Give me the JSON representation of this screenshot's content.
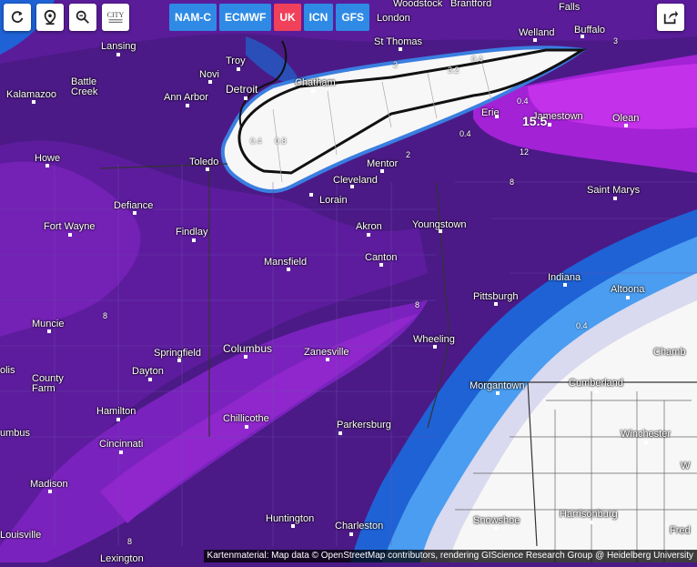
{
  "controls": {
    "refresh_icon": "refresh-icon",
    "location_icon": "location-pin-icon",
    "zoom_icon": "zoom-out-icon",
    "city_label": "CITY",
    "share_icon": "share-icon"
  },
  "models": [
    {
      "label": "NAM-C",
      "active": false
    },
    {
      "label": "ECMWF",
      "active": false
    },
    {
      "label": "UK",
      "active": true
    },
    {
      "label": "ICN",
      "active": false
    },
    {
      "label": "GFS",
      "active": false
    }
  ],
  "cities": {
    "woodstock": "Woodstock",
    "brantford": "Brantford",
    "falls": "Falls",
    "london": "London",
    "welland": "Welland",
    "buffalo": "Buffalo",
    "lansing": "Lansing",
    "troy": "Troy",
    "st_thomas": "St Thomas",
    "novi": "Novi",
    "battle_creek": "Battle Creek",
    "detroit": "Detroit",
    "chatham": "Chatham",
    "kalamazoo": "Kalamazoo",
    "ann_arbor": "Ann Arbor",
    "erie": "Erie",
    "jamestown": "Jamestown",
    "olean": "Olean",
    "howe": "Howe",
    "toledo": "Toledo",
    "mentor": "Mentor",
    "cleveland": "Cleveland",
    "lorain": "Lorain",
    "saint_marys": "Saint Marys",
    "defiance": "Defiance",
    "fort_wayne": "Fort Wayne",
    "akron": "Akron",
    "youngstown": "Youngstown",
    "findlay": "Findlay",
    "mansfield": "Mansfield",
    "canton": "Canton",
    "indiana": "Indiana",
    "altoona": "Altoona",
    "pittsburgh": "Pittsburgh",
    "muncie": "Muncie",
    "springfield": "Springfield",
    "columbus": "Columbus",
    "zanesville": "Zanesville",
    "wheeling": "Wheeling",
    "chambersburg": "Chamb",
    "dayton": "Dayton",
    "county_farm": "County Farm",
    "morgantown": "Morgantown",
    "cumberland": "Cumberland",
    "hamilton": "Hamilton",
    "chillicothe": "Chillicothe",
    "parkersburg": "Parkersburg",
    "winchester": "Winchester",
    "columbus_in": "umbus",
    "cincinnati": "Cincinnati",
    "indianapolis": "olis",
    "madison": "Madison",
    "huntington": "Huntington",
    "charleston": "Charleston",
    "snowshoe": "Snowshoe",
    "harrisonburg": "Harrisonburg",
    "louisville": "Louisville",
    "lexington": "Lexington",
    "frederick": "Fred",
    "w_edge": "W"
  },
  "contour_labels": {
    "c1": "0.4",
    "c2": "0.8",
    "c3": "3.2",
    "c4": "0.4",
    "c5": "0.4",
    "c6": "12",
    "c7": "0.4",
    "c8": "2",
    "c9": "8",
    "c10": "8",
    "c11": "8",
    "c12": "0.4",
    "c13": "2",
    "c14": "8",
    "c15": "3"
  },
  "max_value": "15.5",
  "attribution": "Kartenmaterial: Map data © OpenStreetMap contributors, rendering GIScience Research Group @ Heidelberg University",
  "colors": {
    "deep_purple": "#4b1a86",
    "purple": "#6a1fa8",
    "magenta": "#a322d6",
    "bright_magenta": "#c431ea",
    "blue": "#1e62d6",
    "light_blue": "#4a9df0",
    "pale": "#d9d9ef",
    "lake": "#f7f7f7"
  }
}
